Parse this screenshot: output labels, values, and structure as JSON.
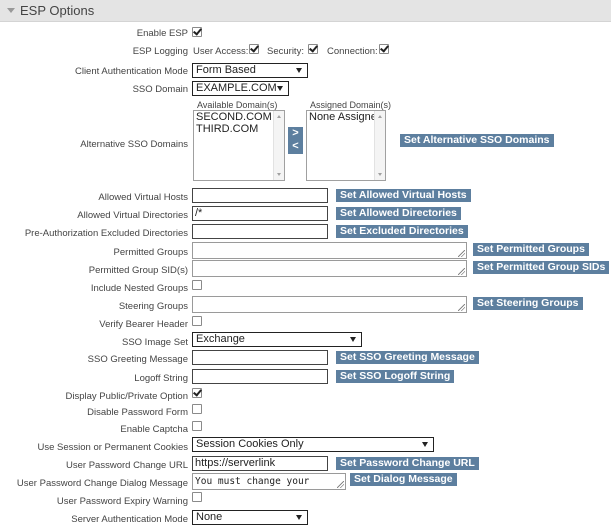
{
  "section": {
    "title": "ESP Options"
  },
  "enable_esp": {
    "label": "Enable ESP",
    "checked": true
  },
  "esp_logging": {
    "label": "ESP Logging",
    "user_access": {
      "label": "User Access:",
      "checked": true
    },
    "security": {
      "label": "Security:",
      "checked": true
    },
    "connection": {
      "label": "Connection:",
      "checked": true
    }
  },
  "client_auth_mode": {
    "label": "Client Authentication Mode",
    "value": "Form Based"
  },
  "sso_domain": {
    "label": "SSO Domain",
    "value": "EXAMPLE.COM"
  },
  "alt_sso": {
    "label": "Alternative SSO Domains",
    "available_header": "Available Domain(s)",
    "assigned_header": "Assigned Domain(s)",
    "available": [
      "SECOND.COM",
      "THIRD.COM"
    ],
    "assigned": [
      "None Assigned"
    ],
    "add_symbol": ">",
    "remove_symbol": "<",
    "button": "Set Alternative SSO Domains"
  },
  "allowed_virtual_hosts": {
    "label": "Allowed Virtual Hosts",
    "value": "",
    "button": "Set Allowed Virtual Hosts"
  },
  "allowed_virtual_dirs": {
    "label": "Allowed Virtual Directories",
    "value": "/*",
    "button": "Set Allowed Directories"
  },
  "pre_auth_excluded": {
    "label": "Pre-Authorization Excluded Directories",
    "value": "",
    "button": "Set Excluded Directories"
  },
  "permitted_groups": {
    "label": "Permitted Groups",
    "value": "",
    "button": "Set Permitted Groups"
  },
  "permitted_group_sids": {
    "label": "Permitted Group SID(s)",
    "value": "",
    "button": "Set Permitted Group SIDs"
  },
  "include_nested": {
    "label": "Include Nested Groups",
    "checked": false
  },
  "steering_groups": {
    "label": "Steering Groups",
    "value": "",
    "button": "Set Steering Groups"
  },
  "verify_bearer": {
    "label": "Verify Bearer Header",
    "checked": false
  },
  "sso_image_set": {
    "label": "SSO Image Set",
    "value": "Exchange"
  },
  "sso_greeting": {
    "label": "SSO Greeting Message",
    "value": "",
    "button": "Set SSO Greeting Message"
  },
  "logoff_string": {
    "label": "Logoff String",
    "value": "",
    "button": "Set SSO Logoff String"
  },
  "display_public_private": {
    "label": "Display Public/Private Option",
    "checked": true
  },
  "disable_password_form": {
    "label": "Disable Password Form",
    "checked": false
  },
  "enable_captcha": {
    "label": "Enable Captcha",
    "checked": false
  },
  "cookies": {
    "label": "Use Session or Permanent Cookies",
    "value": "Session Cookies Only"
  },
  "pw_change_url": {
    "label": "User Password Change URL",
    "value": "https://serverlink",
    "button": "Set Password Change URL"
  },
  "pw_change_dialog": {
    "label": "User Password Change Dialog Message",
    "value": "You must change your",
    "button": "Set Dialog Message"
  },
  "pw_expiry_warning": {
    "label": "User Password Expiry Warning",
    "checked": false
  },
  "server_auth_mode": {
    "label": "Server Authentication Mode",
    "value": "None"
  }
}
